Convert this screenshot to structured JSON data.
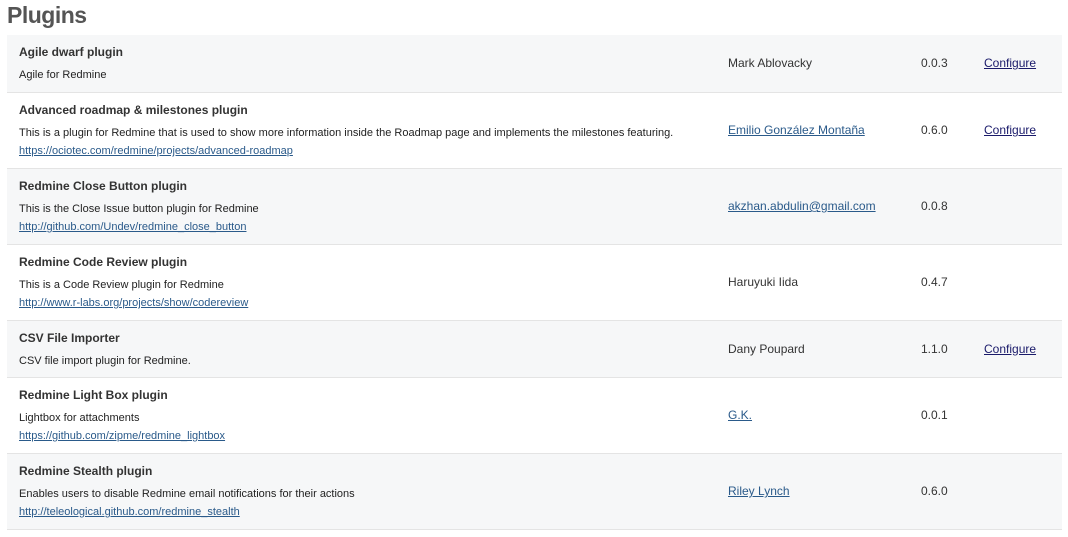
{
  "page": {
    "title": "Plugins"
  },
  "plugins": [
    {
      "name": "Agile dwarf plugin",
      "description": "Agile for Redmine",
      "url": "",
      "author": "Mark Ablovacky",
      "author_link": false,
      "version": "0.0.3",
      "configure": "Configure"
    },
    {
      "name": "Advanced roadmap & milestones plugin",
      "description": "This is a plugin for Redmine that is used to show more information inside the Roadmap page and implements the milestones featuring.",
      "url": "https://ociotec.com/redmine/projects/advanced-roadmap",
      "author": "Emilio González Montaña",
      "author_link": true,
      "version": "0.6.0",
      "configure": "Configure"
    },
    {
      "name": "Redmine Close Button plugin",
      "description": "This is the Close Issue button plugin for Redmine",
      "url": "http://github.com/Undev/redmine_close_button",
      "author": "akzhan.abdulin@gmail.com",
      "author_link": true,
      "version": "0.0.8",
      "configure": ""
    },
    {
      "name": "Redmine Code Review plugin",
      "description": "This is a Code Review plugin for Redmine",
      "url": "http://www.r-labs.org/projects/show/codereview",
      "author": "Haruyuki Iida",
      "author_link": false,
      "version": "0.4.7",
      "configure": ""
    },
    {
      "name": "CSV File Importer",
      "description": "CSV file import plugin for Redmine.",
      "url": "",
      "author": "Dany Poupard",
      "author_link": false,
      "version": "1.1.0",
      "configure": "Configure"
    },
    {
      "name": "Redmine Light Box plugin",
      "description": "Lightbox for attachments",
      "url": "https://github.com/zipme/redmine_lightbox",
      "author": "G.K.",
      "author_link": true,
      "version": "0.0.1",
      "configure": ""
    },
    {
      "name": "Redmine Stealth plugin",
      "description": "Enables users to disable Redmine email notifications for their actions",
      "url": "http://teleological.github.com/redmine_stealth",
      "author": "Riley Lynch",
      "author_link": true,
      "version": "0.6.0",
      "configure": ""
    }
  ]
}
